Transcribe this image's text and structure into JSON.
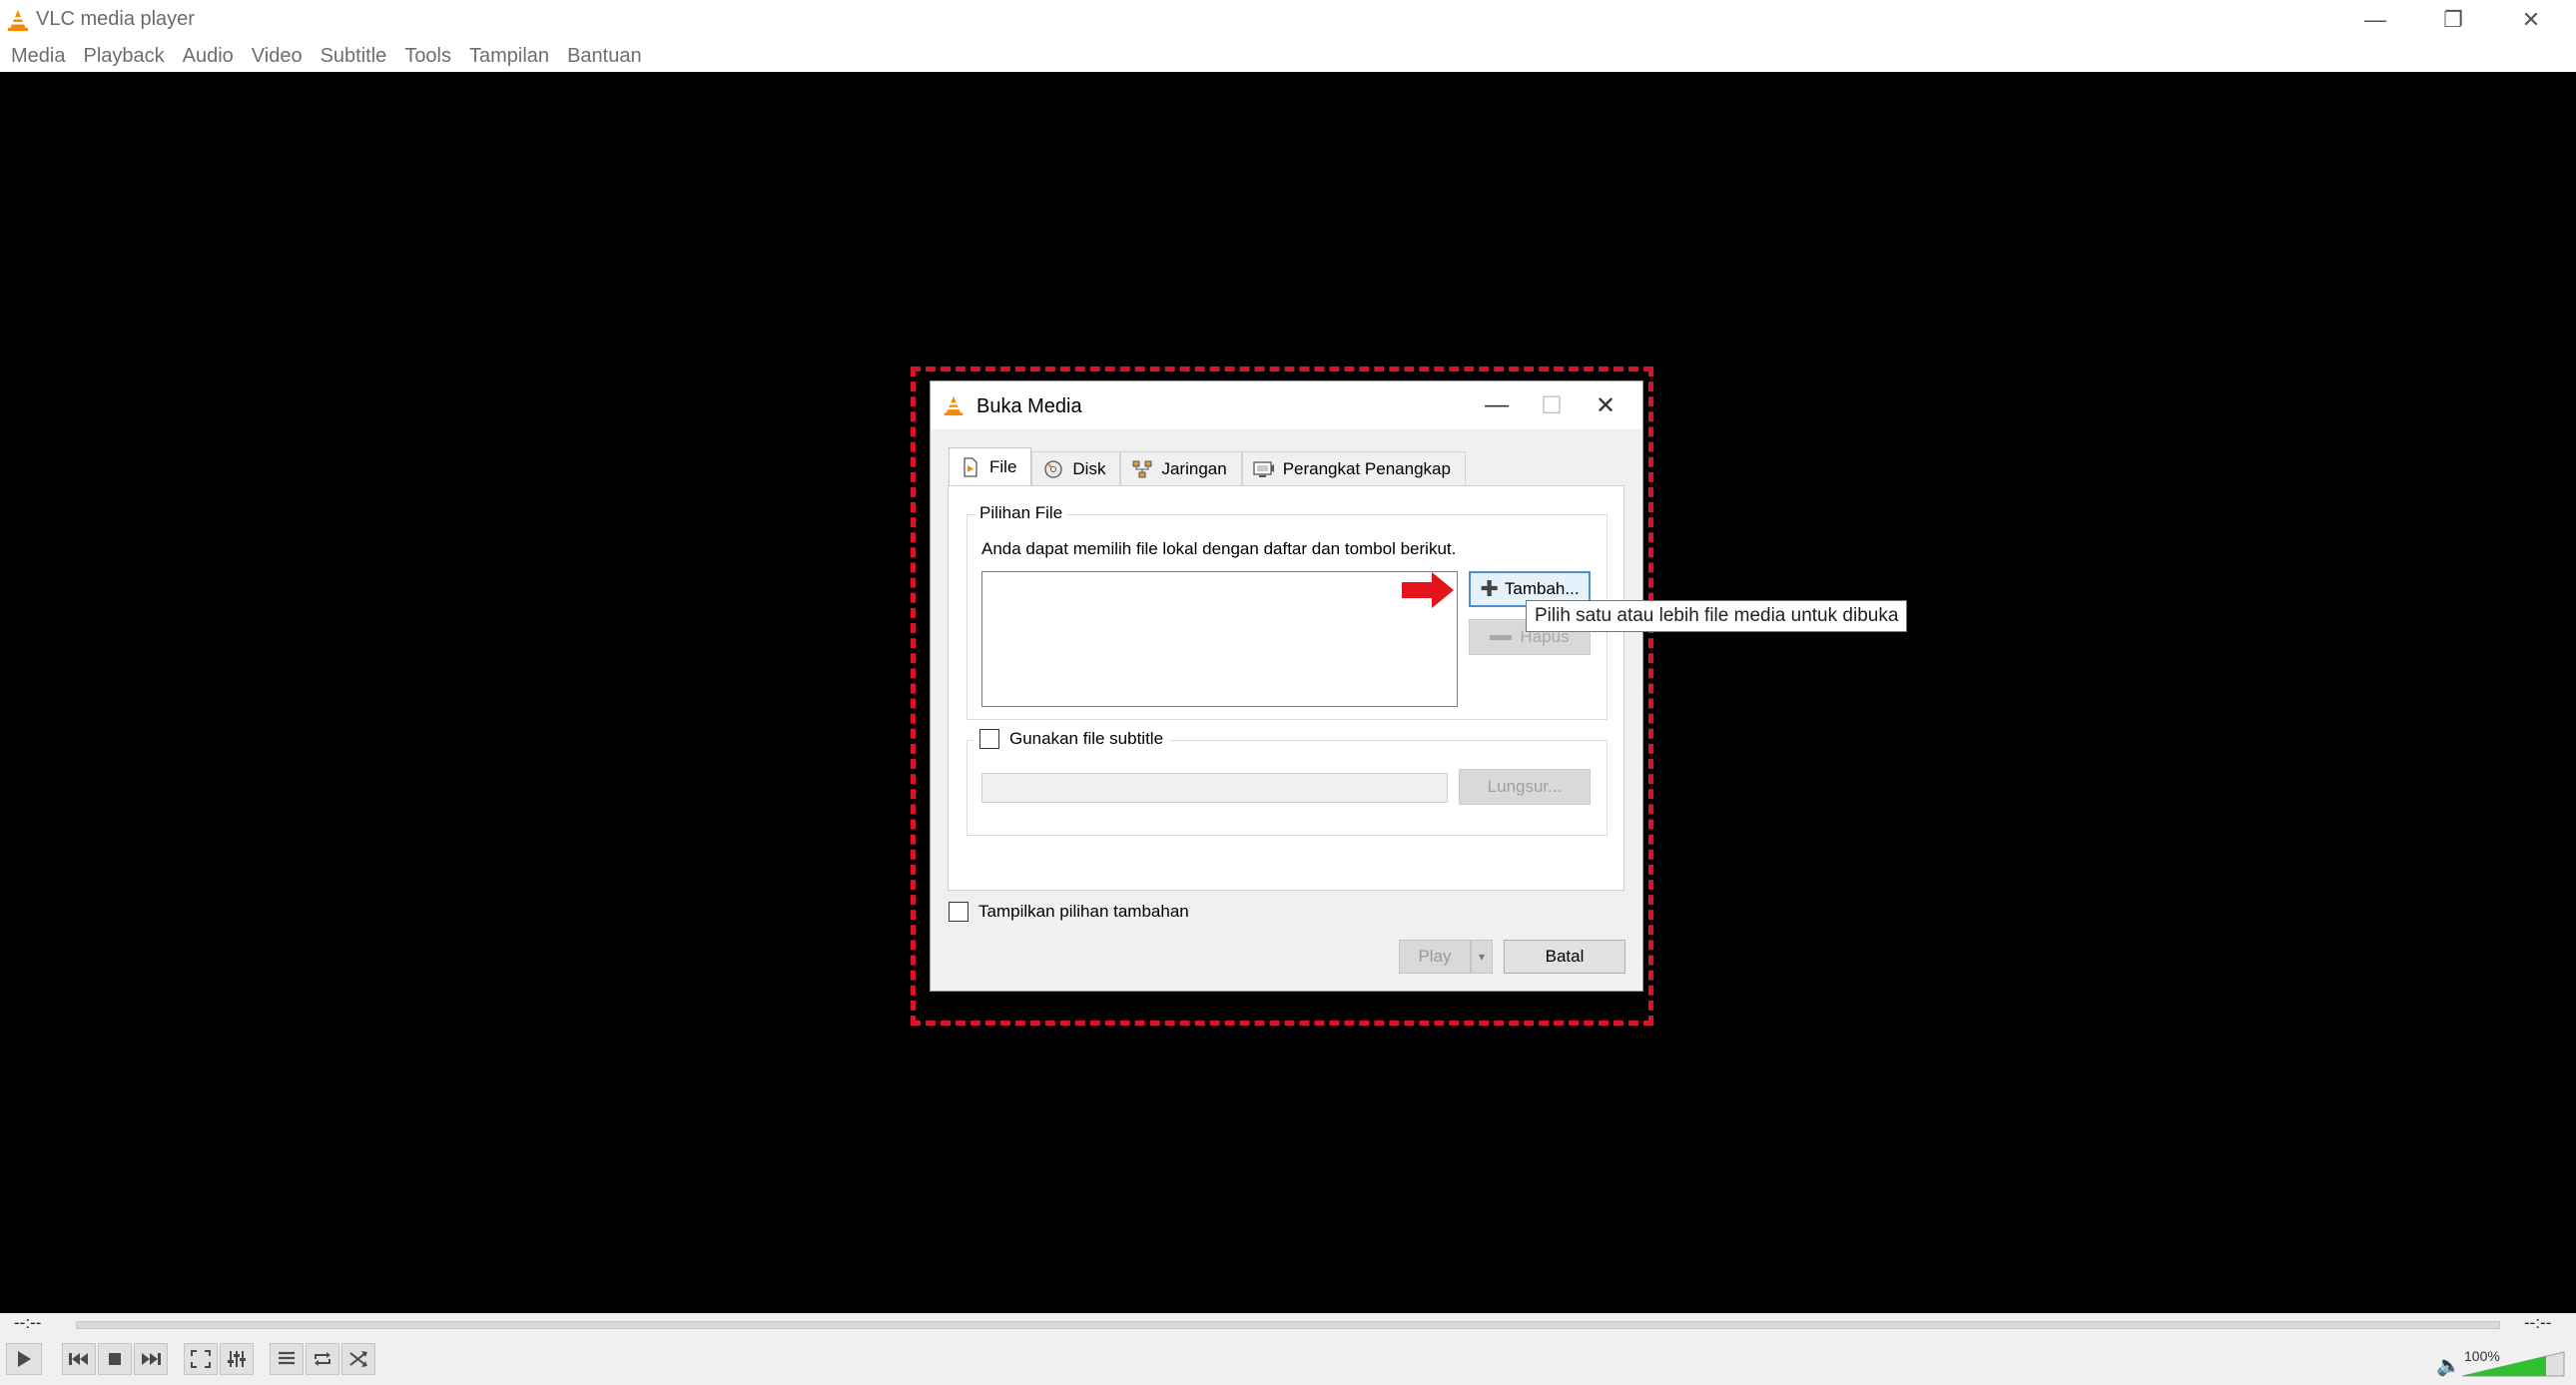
{
  "app": {
    "title": "VLC media player",
    "window_controls": {
      "minimize": "—",
      "maximize": "❐",
      "close": "✕"
    }
  },
  "menu": [
    "Media",
    "Playback",
    "Audio",
    "Video",
    "Subtitle",
    "Tools",
    "Tampilan",
    "Bantuan"
  ],
  "dialog": {
    "title": "Buka Media",
    "controls": {
      "minimize": "—",
      "maximize": "☐",
      "close": "✕"
    },
    "tabs": [
      {
        "label": "File",
        "icon": "file-icon",
        "active": true
      },
      {
        "label": "Disk",
        "icon": "disc-icon",
        "active": false
      },
      {
        "label": "Jaringan",
        "icon": "network-icon",
        "active": false
      },
      {
        "label": "Perangkat Penangkap",
        "icon": "capture-device-icon",
        "active": false
      }
    ],
    "file_group": {
      "title": "Pilihan File",
      "description": "Anda dapat memilih file lokal dengan daftar dan tombol berikut.",
      "add_button": "Tambah...",
      "remove_button": "Hapus"
    },
    "subtitle_group": {
      "checkbox_label": "Gunakan file subtitle",
      "checked": false,
      "path_value": "",
      "browse_button": "Lungsur..."
    },
    "more_options": {
      "label": "Tampilkan pilihan tambahan",
      "checked": false
    },
    "play_button": "Play",
    "play_dropdown": "▾",
    "cancel_button": "Batal"
  },
  "tooltip": "Pilih satu atau lebih file media untuk dibuka",
  "controls": {
    "time_elapsed": "--:--",
    "time_total": "--:--",
    "volume": "100%",
    "icons": [
      "play-icon",
      "previous-icon",
      "stop-icon",
      "next-icon",
      "fullscreen-icon",
      "extended-settings-icon",
      "playlist-icon",
      "loop-icon",
      "shuffle-icon",
      "volume-icon"
    ]
  },
  "colors": {
    "highlight": "#d8132b",
    "vlc_orange": "#f48b00",
    "volume_green": "#2fbf2f",
    "focus_blue": "#4d8ed2"
  }
}
